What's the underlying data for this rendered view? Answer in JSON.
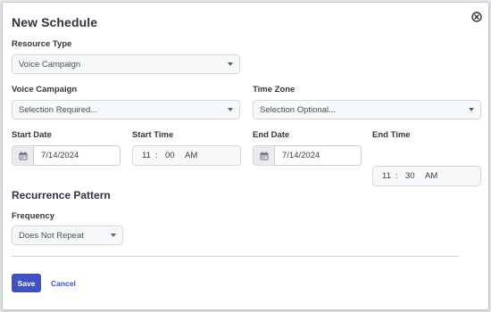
{
  "dialog": {
    "title": "New Schedule",
    "close_icon": "close-circle-icon"
  },
  "resource_type": {
    "label": "Resource Type",
    "value": "Voice Campaign"
  },
  "voice_campaign": {
    "label": "Voice Campaign",
    "value": "Selection Required..."
  },
  "time_zone": {
    "label": "Time Zone",
    "value": "Selection Optional..."
  },
  "start_date": {
    "label": "Start Date",
    "value": "7/14/2024",
    "icon": "calendar-icon"
  },
  "start_time": {
    "label": "Start Time",
    "hour": "11",
    "sep": ":",
    "minute": "00",
    "ampm": "AM"
  },
  "end_date": {
    "label": "End Date",
    "value": "7/14/2024",
    "icon": "calendar-icon"
  },
  "end_time": {
    "label": "End Time",
    "hour": "11",
    "sep": ":",
    "minute": "30",
    "ampm": "AM"
  },
  "recurrence": {
    "title": "Recurrence Pattern",
    "frequency_label": "Frequency",
    "frequency_value": "Does Not Repeat"
  },
  "actions": {
    "save_label": "Save",
    "cancel_label": "Cancel"
  },
  "colors": {
    "accent": "#3f51c4",
    "dialog_bg": "#ffffff",
    "field_bg": "#f7f8f9",
    "border": "#d6d9de"
  }
}
